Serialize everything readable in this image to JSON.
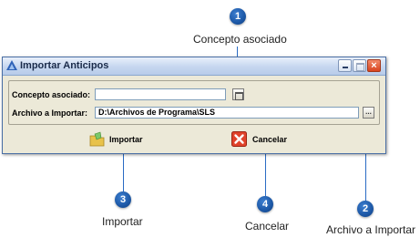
{
  "window": {
    "title": "Importar Anticipos",
    "controls": {
      "minimize": "minimize",
      "maximize": "maximize",
      "close": "×"
    }
  },
  "form": {
    "concepto_label": "Concepto asociado:",
    "concepto_value": "",
    "archivo_label": "Archivo a Importar:",
    "archivo_value": "D:\\Archivos de Programa\\SLS",
    "browse_label": "..."
  },
  "actions": {
    "importar": "Importar",
    "cancelar": "Cancelar"
  },
  "callouts": [
    {
      "number": "1",
      "label": "Concepto asociado"
    },
    {
      "number": "2",
      "label": "Archivo a Importar"
    },
    {
      "number": "3",
      "label": "Importar"
    },
    {
      "number": "4",
      "label": "Cancelar"
    }
  ],
  "colors": {
    "badge": "#1c57a5",
    "window_bg": "#ece9d8",
    "titlebar": "#c8d8f0",
    "close_button": "#d8431e"
  }
}
